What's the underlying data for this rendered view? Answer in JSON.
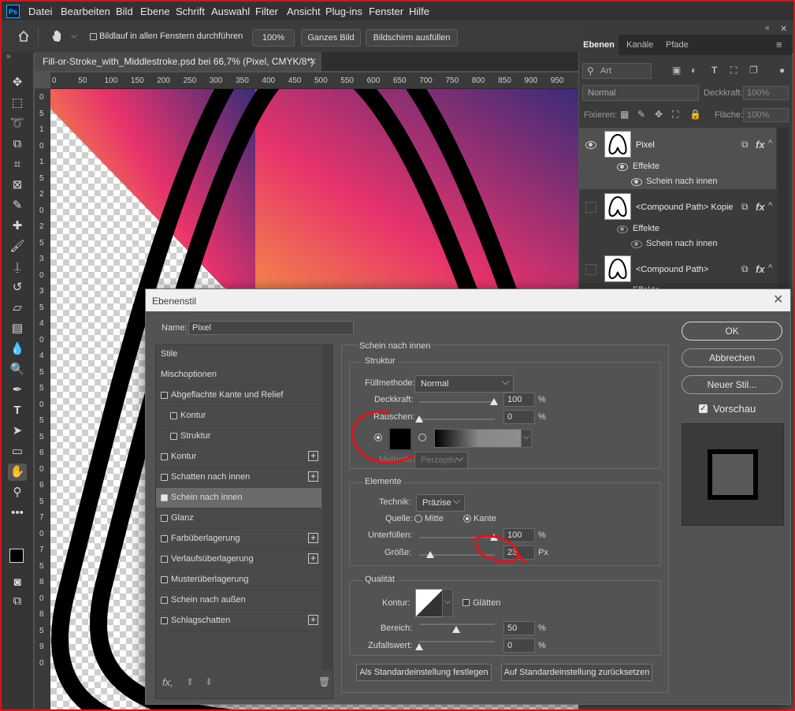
{
  "menubar": {
    "app_badge": "Ps",
    "items": [
      "Datei",
      "Bearbeiten",
      "Bild",
      "Ebene",
      "Schrift",
      "Auswahl",
      "Filter",
      "Ansicht",
      "Plug-ins",
      "Fenster",
      "Hilfe"
    ]
  },
  "options_bar": {
    "scroll_all_label": "Bildlauf in allen Fenstern durchführen",
    "zoom_value": "100%",
    "fit_screen": "Ganzes Bild",
    "fill_screen": "Bildschirm ausfüllen"
  },
  "document": {
    "tab_title": "Fill-or-Stroke_with_Middlestroke.psd bei 66,7% (Pixel, CMYK/8*)",
    "ruler_ticks": [
      "0",
      "50",
      "100",
      "150",
      "200",
      "250",
      "300",
      "350",
      "400",
      "450",
      "500",
      "550",
      "600",
      "650",
      "700",
      "750",
      "800",
      "850",
      "900",
      "950"
    ],
    "ruler_v_ticks": [
      "0",
      "5",
      "1",
      "0",
      "1",
      "5",
      "2",
      "0",
      "2",
      "5",
      "3",
      "0",
      "3",
      "5",
      "4",
      "0",
      "4",
      "5",
      "5",
      "0",
      "5",
      "5",
      "6",
      "0",
      "6",
      "5",
      "7",
      "0",
      "7",
      "5",
      "8",
      "0",
      "8",
      "5",
      "9",
      "0"
    ]
  },
  "layers_panel": {
    "tabs": [
      "Ebenen",
      "Kanäle",
      "Pfade"
    ],
    "filter_placeholder": "Art",
    "blend_mode": "Normal",
    "opacity_label": "Deckkraft:",
    "opacity_value": "100%",
    "lock_label": "Fixieren:",
    "fill_label": "Fläche:",
    "fill_value": "100%",
    "layers": [
      {
        "name": "Pixel",
        "effects_label": "Effekte",
        "effect": "Schein nach innen"
      },
      {
        "name": "<Compound Path> Kopie",
        "effects_label": "Effekte",
        "effect": "Schein nach innen"
      },
      {
        "name": "<Compound Path>",
        "effects_label": "Effekte"
      }
    ]
  },
  "dialog": {
    "title": "Ebenenstil",
    "name_label": "Name:",
    "name_value": "Pixel",
    "styles": [
      {
        "label": "Stile",
        "checkbox": false,
        "plus": false,
        "indent": false,
        "checked": false
      },
      {
        "label": "Mischoptionen",
        "checkbox": false,
        "plus": false,
        "indent": false,
        "checked": false
      },
      {
        "label": "Abgeflachte Kante und Relief",
        "checkbox": true,
        "plus": false,
        "indent": false,
        "checked": false
      },
      {
        "label": "Kontur",
        "checkbox": true,
        "plus": false,
        "indent": true,
        "checked": false
      },
      {
        "label": "Struktur",
        "checkbox": true,
        "plus": false,
        "indent": true,
        "checked": false
      },
      {
        "label": "Kontur",
        "checkbox": true,
        "plus": true,
        "indent": false,
        "checked": false
      },
      {
        "label": "Schatten nach innen",
        "checkbox": true,
        "plus": true,
        "indent": false,
        "checked": false
      },
      {
        "label": "Schein nach innen",
        "checkbox": true,
        "plus": false,
        "indent": false,
        "checked": true
      },
      {
        "label": "Glanz",
        "checkbox": true,
        "plus": false,
        "indent": false,
        "checked": false
      },
      {
        "label": "Farbüberlagerung",
        "checkbox": true,
        "plus": true,
        "indent": false,
        "checked": false
      },
      {
        "label": "Verlaufsüberlagerung",
        "checkbox": true,
        "plus": true,
        "indent": false,
        "checked": false
      },
      {
        "label": "Musterüberlagerung",
        "checkbox": true,
        "plus": false,
        "indent": false,
        "checked": false
      },
      {
        "label": "Schein nach außen",
        "checkbox": true,
        "plus": false,
        "indent": false,
        "checked": false
      },
      {
        "label": "Schlagschatten",
        "checkbox": true,
        "plus": true,
        "indent": false,
        "checked": false
      }
    ],
    "section_title": "Schein nach innen",
    "struktur": {
      "title": "Struktur",
      "blend_label": "Füllmethode:",
      "blend_value": "Normal",
      "opacity_label": "Deckkraft:",
      "opacity_value": "100",
      "opacity_pct": 1.0,
      "noise_label": "Rauschen:",
      "noise_value": "0",
      "method_label": "Methode:",
      "method_value": "Perzeptiv",
      "unit": "%"
    },
    "elemente": {
      "title": "Elemente",
      "technique_label": "Technik:",
      "technique_value": "Präzise",
      "source_label": "Quelle:",
      "source_center": "Mitte",
      "source_edge": "Kante",
      "choke_label": "Unterfüllen:",
      "choke_value": "100",
      "size_label": "Größe:",
      "size_value": "23",
      "size_unit": "Px"
    },
    "qualitaet": {
      "title": "Qualität",
      "contour_label": "Kontur:",
      "antialias_label": "Glätten",
      "range_label": "Bereich:",
      "range_value": "50",
      "jitter_label": "Zufallswert:",
      "jitter_value": "0"
    },
    "btn_make_default": "Als Standardeinstellung festlegen",
    "btn_reset_default": "Auf Standardeinstellung zurücksetzen",
    "btn_ok": "OK",
    "btn_cancel": "Abbrechen",
    "btn_new_style": "Neuer Stil...",
    "preview_label": "Vorschau"
  }
}
